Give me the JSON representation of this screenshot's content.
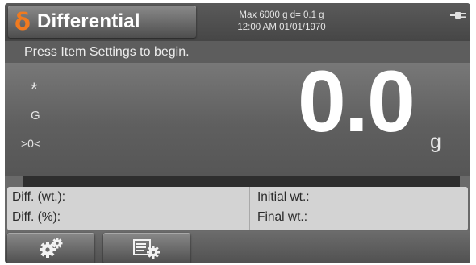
{
  "header": {
    "app_name": "Differential",
    "app_icon": "δ",
    "app_icon_color": "#f07a1f",
    "capacity_line": "Max 6000 g  d= 0.1 g",
    "datetime_line": "12:00 AM   01/01/1970",
    "power_icon": "plug-icon"
  },
  "instruction": "Press Item Settings to begin.",
  "display": {
    "stability_indicator": "*",
    "gross_indicator": "G",
    "center_zero_indicator": ">0<",
    "weight_value": "0.0",
    "unit": "g"
  },
  "progress": {
    "fraction": 0.0,
    "fill_color": "#7ac143"
  },
  "results": {
    "diff_wt_label": "Diff. (wt.):",
    "diff_pct_label": "Diff. (%):",
    "initial_wt_label": "Initial wt.:",
    "final_wt_label": "Final wt.:"
  },
  "softkeys": [
    {
      "icon": "gears-icon",
      "purpose": "application-settings"
    },
    {
      "icon": "item-settings-icon",
      "purpose": "item-settings"
    }
  ]
}
